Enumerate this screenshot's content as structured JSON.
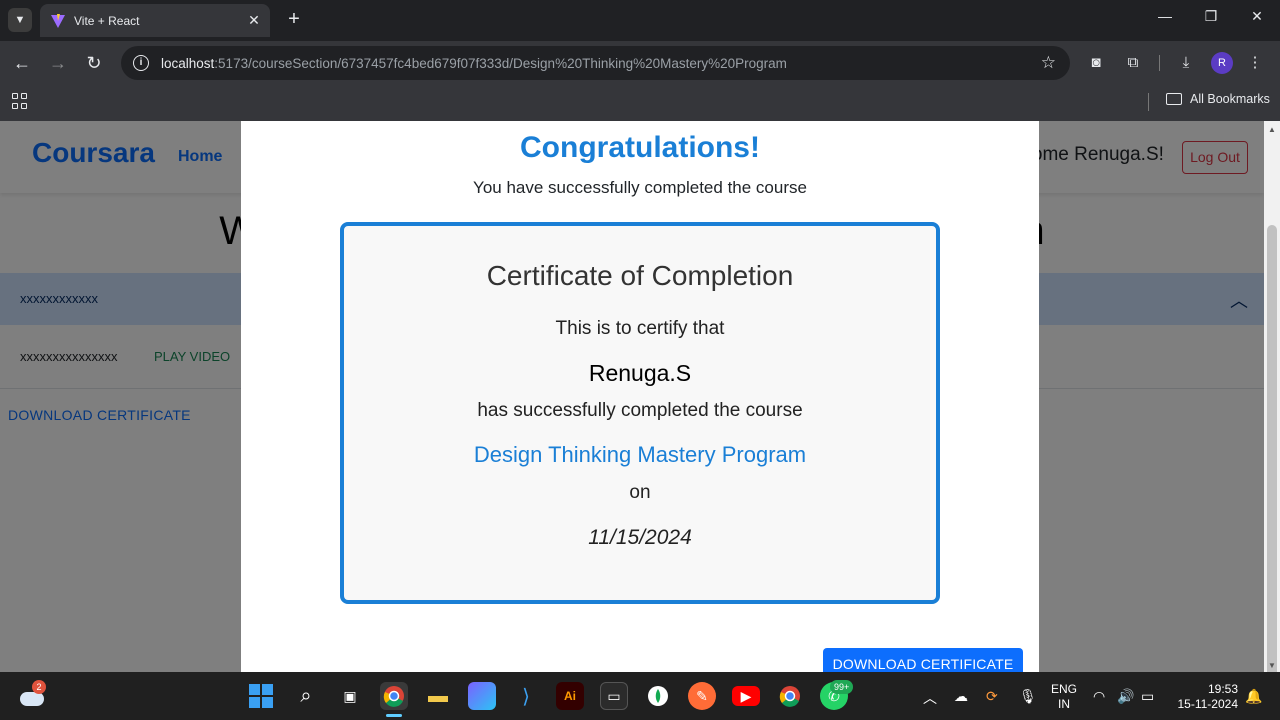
{
  "browser": {
    "tab_title": "Vite + React",
    "url_host": "localhost",
    "url_rest": ":5173/courseSection/6737457fc4bed679f07f333d/Design%20Thinking%20Mastery%20Program",
    "bookmarks_label": "All Bookmarks",
    "profile_initial": "R"
  },
  "page": {
    "brand": "Coursara",
    "nav_home": "Home",
    "welcome_user": "Welcome Renuga.S!",
    "logout": "Log Out",
    "title": "Welcome to Design Thinking Mastery Program",
    "section_label": "xxxxxxxxxxxx",
    "lesson_label": "xxxxxxxxxxxxxxx",
    "play_video": "PLAY VIDEO",
    "download_certificate": "DOWNLOAD CERTIFICATE"
  },
  "modal": {
    "heading": "Congratulations!",
    "subheading": "You have successfully completed the course",
    "certificate": {
      "title": "Certificate of Completion",
      "line1": "This is to certify that",
      "name": "Renuga.S",
      "line2": "has successfully completed the course",
      "course": "Design Thinking Mastery Program",
      "on": "on",
      "date": "11/15/2024"
    },
    "download_button": "DOWNLOAD CERTIFICATE"
  },
  "taskbar": {
    "weather_badge": "2",
    "whatsapp_badge": "99+",
    "lang_top": "ENG",
    "lang_bottom": "IN",
    "time": "19:53",
    "date": "15-11-2024"
  },
  "colors": {
    "accent": "#1a7fd6",
    "primary": "#0d6efd",
    "danger": "#dc3545",
    "success": "#198754"
  }
}
